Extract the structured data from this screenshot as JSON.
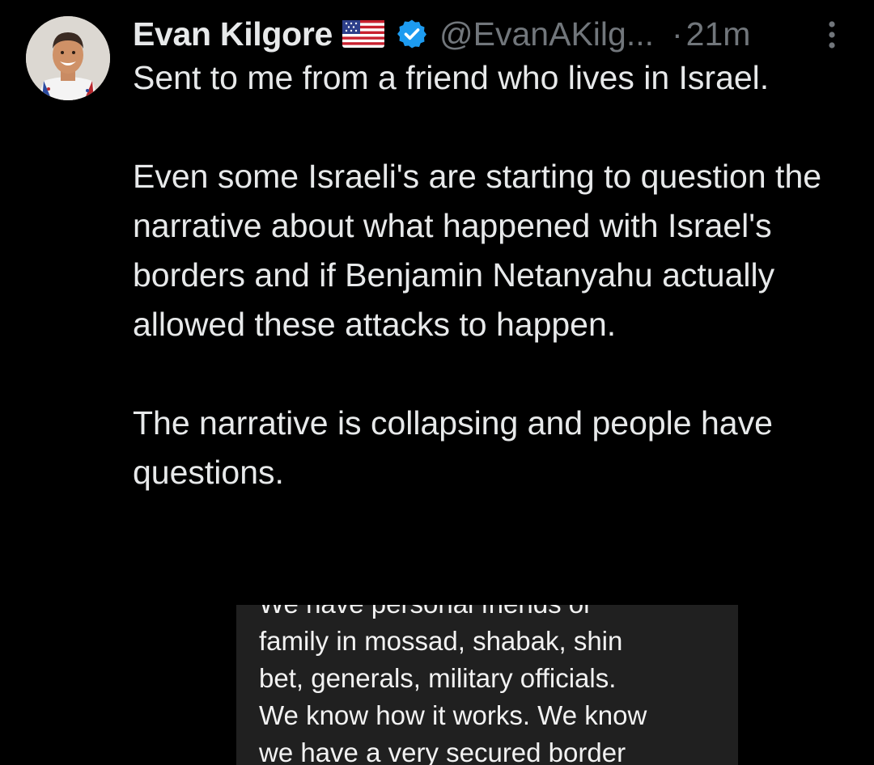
{
  "tweet": {
    "author": {
      "display_name": "Evan Kilgore",
      "handle": "@EvanAKilg...",
      "flag_icon": "us-flag-icon",
      "verified_icon": "verified-badge-icon",
      "verified_color": "#1d9bf0"
    },
    "separator": "·",
    "time": "21m",
    "more_icon": "more-vertical-icon",
    "body_paragraphs": [
      "Sent to me from a friend who lives in Israel.",
      "Even some Israeli's are starting to question the narrative about what happened with Israel's borders and if Benjamin Netanyahu actually allowed these attacks to happen.",
      "The narrative is collapsing and people have questions."
    ],
    "media": {
      "lines": [
        "We have personal friends or",
        "family in mossad, shabak, shin",
        "bet, generals, military officials.",
        "We know how it works. We know",
        "we have a very secured border"
      ]
    }
  },
  "colors": {
    "background": "#000000",
    "text_primary": "#e7e9ea",
    "text_secondary": "#71767b",
    "media_background": "#202020"
  }
}
